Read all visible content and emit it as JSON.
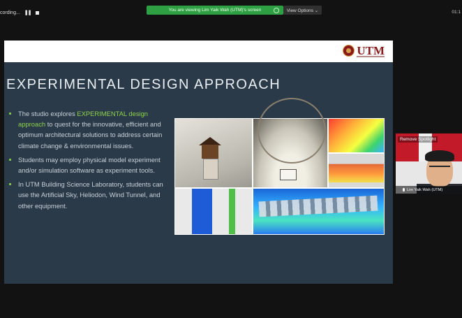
{
  "toolbar": {
    "recording_label": "cording...",
    "pause_icon": "pause-icon",
    "stop_icon": "stop-icon",
    "banner_text": "You are viewing Lim Yaik Wah (UTM)'s screen",
    "view_options_label": "View Options ⌄",
    "clock": "01:1"
  },
  "slide": {
    "logo_text": "UTM",
    "title": "EXPERIMENTAL DESIGN APPROACH",
    "bullets": [
      {
        "pre": "The studio explores ",
        "hl": "EXPERIMENTAL design approach",
        "post": " to quest for the innovative, efficient and optimum architectural solutions to address certain climate change & environmental issues."
      },
      {
        "pre": "Students may employ physical model experiment and/or simulation software as experiment tools.",
        "hl": "",
        "post": ""
      },
      {
        "pre": "In UTM Building Science Laboratory, students can use the Artificial Sky, Heliodon, Wind Tunnel, and other equipment.",
        "hl": "",
        "post": ""
      }
    ]
  },
  "video": {
    "spotlight_button": "Remove Spotlight",
    "participant_name": "Lim Yaik Wah (UTM)"
  },
  "colors": {
    "slide_bg": "#2b3a48",
    "highlight": "#8fd34c",
    "banner": "#2ea043",
    "utm_red": "#8a1a1a"
  }
}
